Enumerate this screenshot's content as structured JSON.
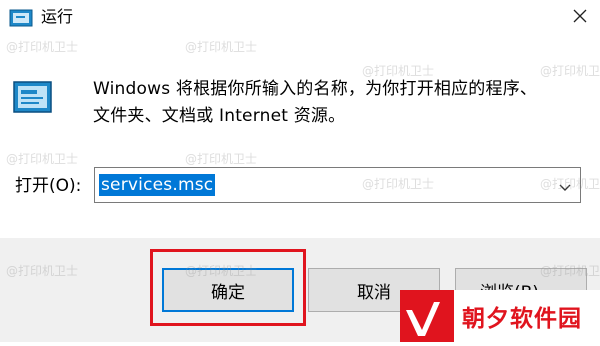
{
  "window": {
    "title": "运行",
    "icon": "run-dialog-icon",
    "close_icon": "close-icon"
  },
  "description": {
    "line1": "Windows 将根据你所输入的名称，为你打开相应的程序、",
    "line2": "文件夹、文档或 Internet 资源。"
  },
  "open_field": {
    "label": "打开(O):",
    "value": "services.msc",
    "dropdown_icon": "chevron-down-icon"
  },
  "buttons": {
    "ok": "确定",
    "cancel": "取消",
    "browse": "浏览(B)..."
  },
  "watermark": {
    "text": "@打印机卫士"
  },
  "logo": {
    "text": "朝夕软件园"
  },
  "colors": {
    "selection": "#0078d7",
    "highlight_box": "#e0141e",
    "logo_red": "#e0141e",
    "footer_bg": "#f0f0f0"
  }
}
